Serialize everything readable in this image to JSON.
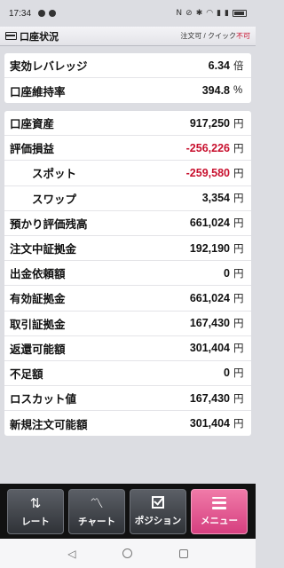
{
  "statusbar": {
    "time": "17:34"
  },
  "header": {
    "title": "口座状況",
    "order_status_label": "注文可 / クイック",
    "order_status_ng": "不可"
  },
  "summary": [
    {
      "label": "実効レバレッジ",
      "value": "6.34",
      "unit": "倍"
    },
    {
      "label": "口座維持率",
      "value": "394.8",
      "unit": "%"
    }
  ],
  "details": [
    {
      "label": "口座資産",
      "value": "917,250",
      "unit": "円"
    },
    {
      "label": "評価損益",
      "value": "-256,226",
      "unit": "円",
      "negative": true
    },
    {
      "label": "スポット",
      "value": "-259,580",
      "unit": "円",
      "negative": true,
      "sub": true
    },
    {
      "label": "スワップ",
      "value": "3,354",
      "unit": "円",
      "sub": true
    },
    {
      "label": "預かり評価残高",
      "value": "661,024",
      "unit": "円"
    },
    {
      "label": "注文中証拠金",
      "value": "192,190",
      "unit": "円"
    },
    {
      "label": "出金依頼額",
      "value": "0",
      "unit": "円"
    },
    {
      "label": "有効証拠金",
      "value": "661,024",
      "unit": "円"
    },
    {
      "label": "取引証拠金",
      "value": "167,430",
      "unit": "円"
    },
    {
      "label": "返還可能額",
      "value": "301,404",
      "unit": "円"
    },
    {
      "label": "不足額",
      "value": "0",
      "unit": "円"
    },
    {
      "label": "ロスカット値",
      "value": "167,430",
      "unit": "円"
    },
    {
      "label": "新規注文可能額",
      "value": "301,404",
      "unit": "円"
    }
  ],
  "nav": {
    "rate": "レート",
    "chart": "チャート",
    "position": "ポジション",
    "menu": "メニュー"
  },
  "colors": {
    "negative": "#c8102e",
    "menu_active": "#d63f7f"
  }
}
